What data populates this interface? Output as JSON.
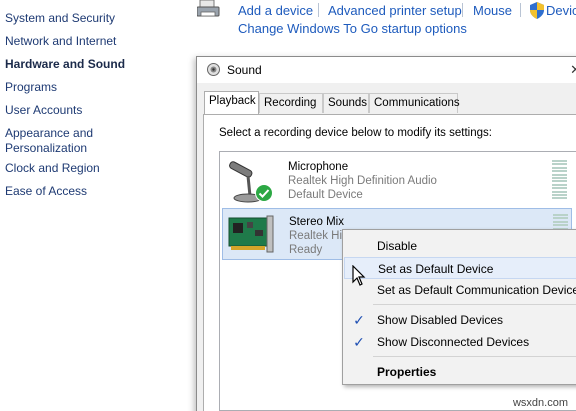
{
  "nav": {
    "items": [
      {
        "label": "System and Security",
        "active": false
      },
      {
        "label": "Network and Internet",
        "active": false
      },
      {
        "label": "Hardware and Sound",
        "active": true
      },
      {
        "label": "Programs",
        "active": false
      },
      {
        "label": "User Accounts",
        "active": false
      },
      {
        "label": "Appearance and Personalization",
        "active": false
      },
      {
        "label": "Clock and Region",
        "active": false
      },
      {
        "label": "Ease of Access",
        "active": false
      }
    ]
  },
  "top_links": {
    "add_device": "Add a device",
    "advanced_printer": "Advanced printer setup",
    "mouse": "Mouse",
    "device_manager": "Devic",
    "windows_to_go": "Change Windows To Go startup options"
  },
  "dialog": {
    "title": "Sound",
    "close_glyph": "✕",
    "tabs": [
      "Playback",
      "Recording",
      "Sounds",
      "Communications"
    ],
    "active_tab": "Playback",
    "instruction": "Select a recording device below to modify its settings:",
    "devices": [
      {
        "name": "Microphone",
        "driver": "Realtek High Definition Audio",
        "status": "Default Device",
        "icon": "microphone-icon",
        "default": true
      },
      {
        "name": "Stereo Mix",
        "driver": "Realtek High Definition Audio",
        "status": "Ready",
        "icon": "sound-card-icon",
        "selected": true
      }
    ]
  },
  "context_menu": {
    "items": [
      {
        "label": "Disable",
        "checked": false
      },
      {
        "label": "Set as Default Device",
        "checked": false,
        "hover": true
      },
      {
        "label": "Set as Default Communication Device",
        "checked": false
      },
      {
        "label": "Show Disabled Devices",
        "checked": true
      },
      {
        "label": "Show Disconnected Devices",
        "checked": true
      },
      {
        "label": "Properties",
        "checked": false,
        "bold": true
      }
    ],
    "check_glyph": "✓"
  },
  "watermark": "wsxdn.com",
  "colors": {
    "link": "#1e5bbd",
    "selected_row": "#dce8f7",
    "check": "#1e4fb3"
  }
}
